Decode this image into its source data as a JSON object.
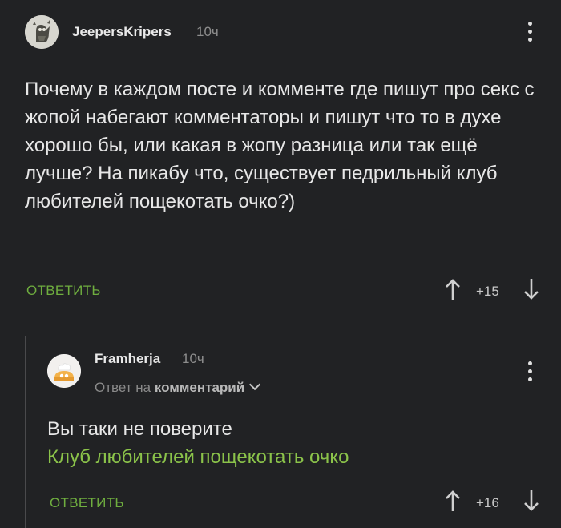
{
  "comments": [
    {
      "username": "JeepersKripers",
      "time": "10ч",
      "text": "Почему в каждом посте и комменте где пишут про секс с жопой набегают комментаторы и пишут что то в духе хорошо бы, или какая в жопу разница или так ещё лучше? На пикабу что, существует педрильный клуб любителей пощекотать очко?)",
      "reply_label": "ОТВЕТИТЬ",
      "score": "+15"
    },
    {
      "username": "Framherja",
      "time": "10ч",
      "reply_to_prefix": "Ответ на",
      "reply_to_target": "комментарий",
      "text_line1": "Вы таки не поверите",
      "text_link": "Клуб любителей пощекотать очко",
      "reply_label": "ОТВЕТИТЬ",
      "score": "+16"
    }
  ],
  "colors": {
    "background": "#212224",
    "accent_green": "#8bc34a",
    "reply_green": "#6fae3f"
  },
  "icons": {
    "more": "more-vertical-icon",
    "upvote": "arrow-up-icon",
    "downvote": "arrow-down-icon",
    "expand": "chevron-down-icon"
  }
}
